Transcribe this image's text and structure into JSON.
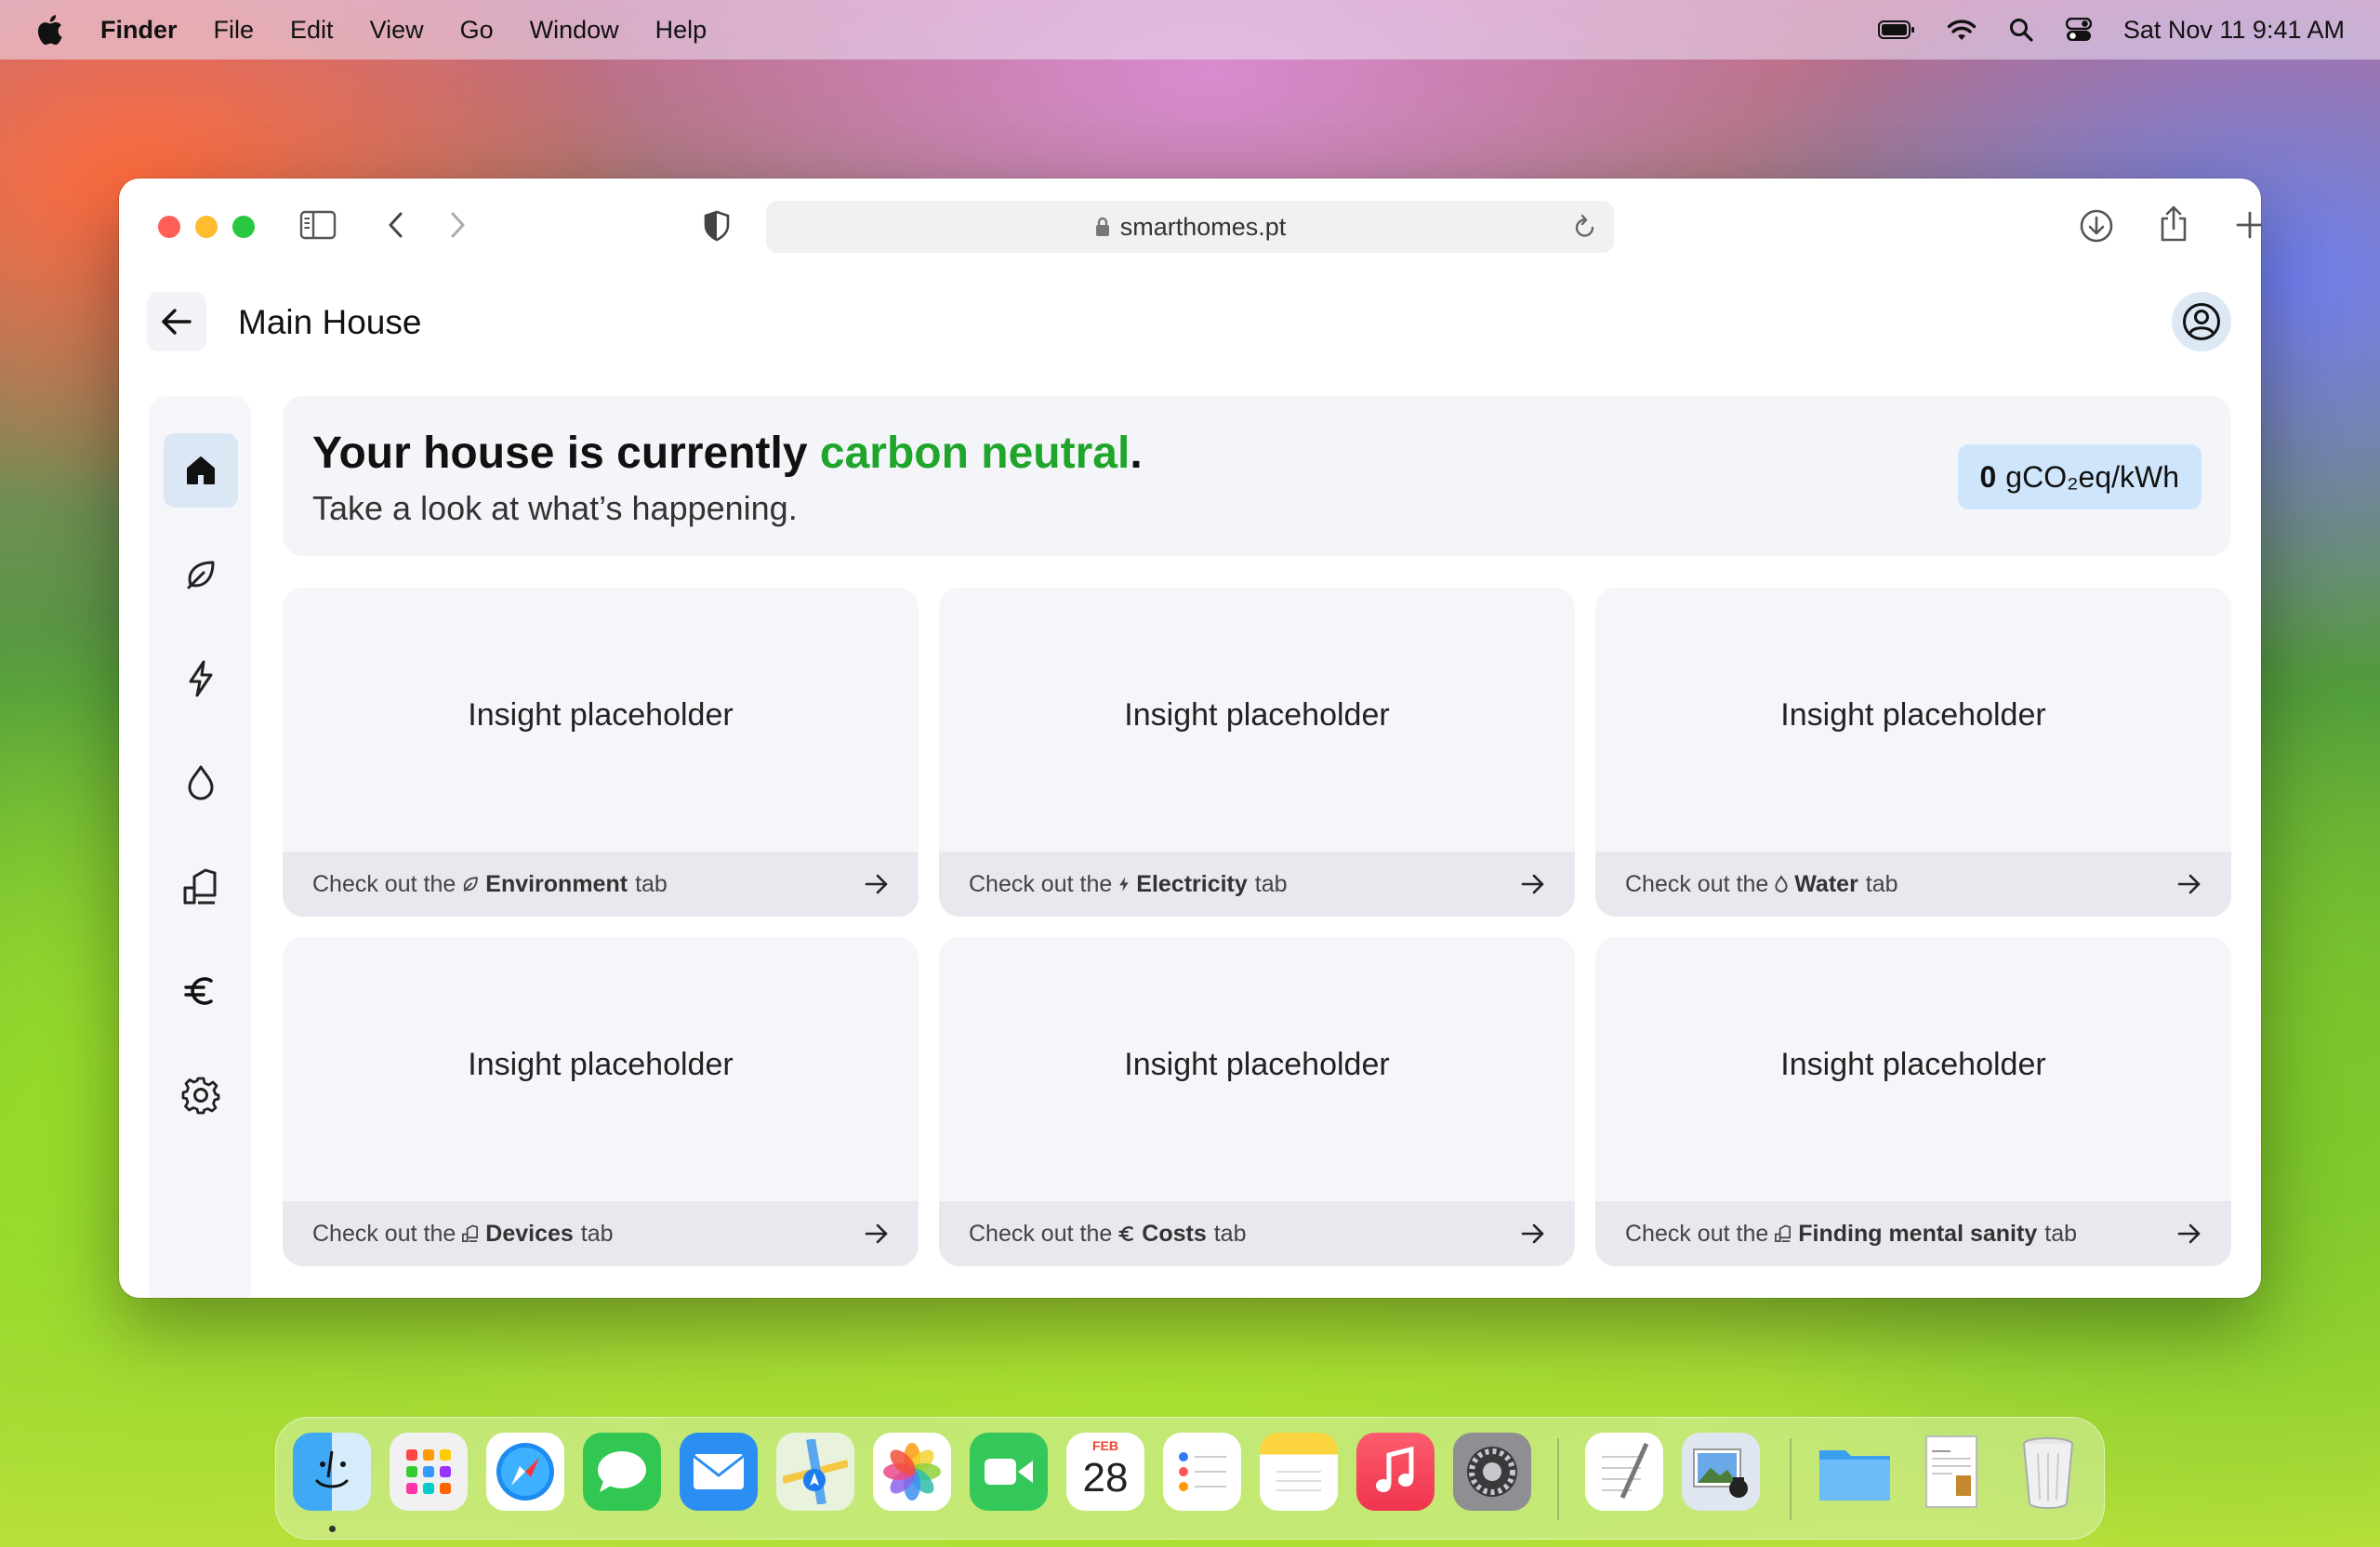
{
  "menubar": {
    "app": "Finder",
    "items": [
      "File",
      "Edit",
      "View",
      "Go",
      "Window",
      "Help"
    ],
    "clock": "Sat Nov 11  9:41 AM"
  },
  "browser": {
    "url": "smarthomes.pt"
  },
  "header": {
    "title": "Main House"
  },
  "hero": {
    "title_prefix": "Your house is currently ",
    "title_accent": "carbon neutral",
    "title_suffix": ".",
    "subtitle": "Take a look at what’s happening.",
    "badge_value": "0",
    "badge_unit": "gCO₂eq/kWh",
    "accent_color": "#1ea52a"
  },
  "sidebar": {
    "items": [
      {
        "icon": "home-icon",
        "active": true
      },
      {
        "icon": "leaf-icon",
        "active": false
      },
      {
        "icon": "lightning-icon",
        "active": false
      },
      {
        "icon": "water-drop-icon",
        "active": false
      },
      {
        "icon": "devices-icon",
        "active": false
      },
      {
        "icon": "euro-icon",
        "active": false
      },
      {
        "icon": "gear-icon",
        "active": false
      }
    ]
  },
  "cards": [
    {
      "title": "Insight placeholder",
      "prefix": "Check out the",
      "tab": "Environment",
      "suffix": "tab",
      "icon": "leaf-icon"
    },
    {
      "title": "Insight placeholder",
      "prefix": "Check out the",
      "tab": "Electricity",
      "suffix": "tab",
      "icon": "lightning-icon"
    },
    {
      "title": "Insight placeholder",
      "prefix": "Check out the",
      "tab": "Water",
      "suffix": "tab",
      "icon": "water-drop-icon"
    },
    {
      "title": "Insight placeholder",
      "prefix": "Check out the",
      "tab": "Devices",
      "suffix": "tab",
      "icon": "devices-icon"
    },
    {
      "title": "Insight placeholder",
      "prefix": "Check out the",
      "tab": "Costs",
      "suffix": "tab",
      "icon": "euro-icon"
    },
    {
      "title": "Insight placeholder",
      "prefix": "Check out the",
      "tab": "Finding mental sanity",
      "suffix": "tab",
      "icon": "devices-icon"
    }
  ],
  "dock": {
    "calendar_month": "FEB",
    "calendar_day": "28",
    "apps": [
      "finder",
      "launchpad",
      "safari",
      "messages",
      "mail",
      "maps",
      "photos",
      "facetime",
      "calendar",
      "reminders",
      "notes",
      "music",
      "system-settings",
      "textedit",
      "preview",
      "folder",
      "document",
      "trash"
    ]
  }
}
